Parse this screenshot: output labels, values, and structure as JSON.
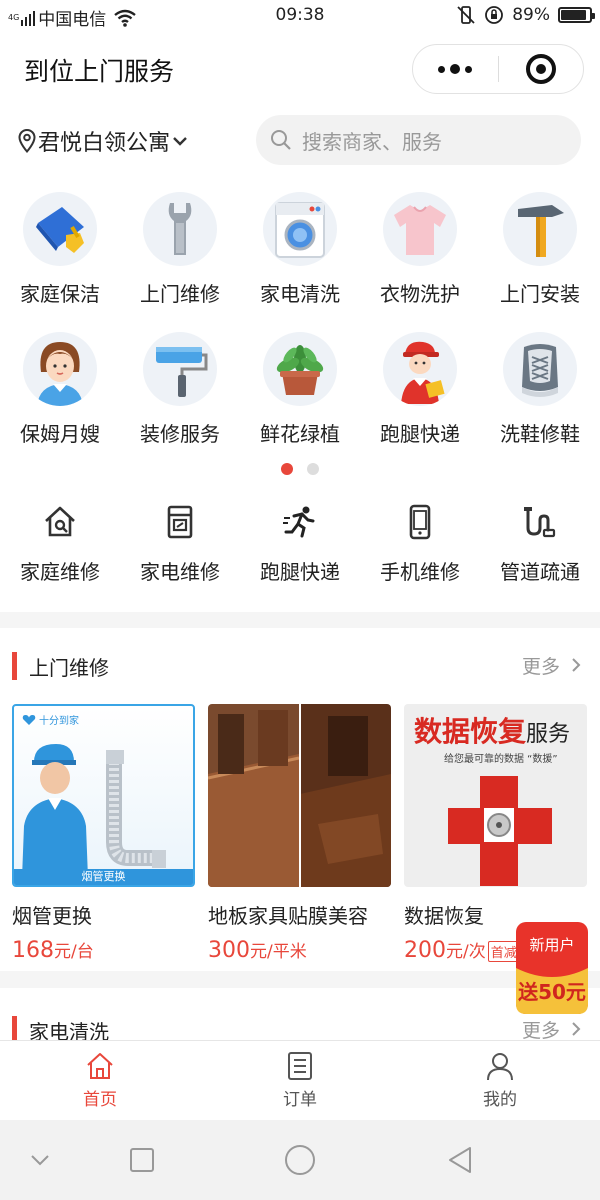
{
  "status_bar": {
    "network": "4G",
    "carrier": "中国电信",
    "time": "09:38",
    "battery_percent": "89%",
    "battery_level": 0.89
  },
  "header": {
    "title": "到位上门服务",
    "more_icon": "more-dots-icon",
    "close_icon": "target-close-icon"
  },
  "location": {
    "name": "君悦白领公寓"
  },
  "search": {
    "placeholder": "搜索商家、服务"
  },
  "categories_row1": [
    {
      "label": "家庭保洁",
      "icon": "cleaning-cloth-icon"
    },
    {
      "label": "上门维修",
      "icon": "wrench-icon"
    },
    {
      "label": "家电清洗",
      "icon": "washing-machine-icon"
    },
    {
      "label": "衣物洗护",
      "icon": "shirt-icon"
    },
    {
      "label": "上门安装",
      "icon": "hammer-icon"
    }
  ],
  "categories_row2": [
    {
      "label": "保姆月嫂",
      "icon": "nanny-icon"
    },
    {
      "label": "装修服务",
      "icon": "paint-roller-icon"
    },
    {
      "label": "鲜花绿植",
      "icon": "potted-plant-icon"
    },
    {
      "label": "跑腿快递",
      "icon": "courier-icon"
    },
    {
      "label": "洗鞋修鞋",
      "icon": "shoe-icon"
    }
  ],
  "pager": {
    "count": 2,
    "active": 0
  },
  "quick_services": [
    {
      "label": "家庭维修",
      "icon": "house-wrench-icon"
    },
    {
      "label": "家电维修",
      "icon": "appliance-icon"
    },
    {
      "label": "跑腿快递",
      "icon": "running-man-icon"
    },
    {
      "label": "手机维修",
      "icon": "phone-icon"
    },
    {
      "label": "管道疏通",
      "icon": "pipe-icon"
    }
  ],
  "section_repair": {
    "title": "上门维修",
    "more": "更多",
    "items": [
      {
        "name": "烟管更换",
        "price": "168",
        "unit": "元/台",
        "image_caption": "烟管更换",
        "image_brand": "十分到家"
      },
      {
        "name": "地板家具贴膜美容",
        "price": "300",
        "unit": "元/平米"
      },
      {
        "name": "数据恢复",
        "price": "200",
        "unit": "元/次",
        "tag": "首减",
        "image_title": "数据恢复",
        "image_title_suffix": "服务",
        "image_subtitle": "给您最可靠的数据 “数援”"
      }
    ]
  },
  "section_appliance": {
    "title": "家电清洗",
    "more": "更多"
  },
  "promo": {
    "line1": "新用户",
    "line2": "送50元"
  },
  "tabbar": [
    {
      "label": "首页",
      "icon": "home-icon",
      "active": true
    },
    {
      "label": "订单",
      "icon": "order-list-icon",
      "active": false
    },
    {
      "label": "我的",
      "icon": "user-icon",
      "active": false
    }
  ],
  "colors": {
    "accent": "#e8473b",
    "icon_bg": "#eef2f7"
  }
}
